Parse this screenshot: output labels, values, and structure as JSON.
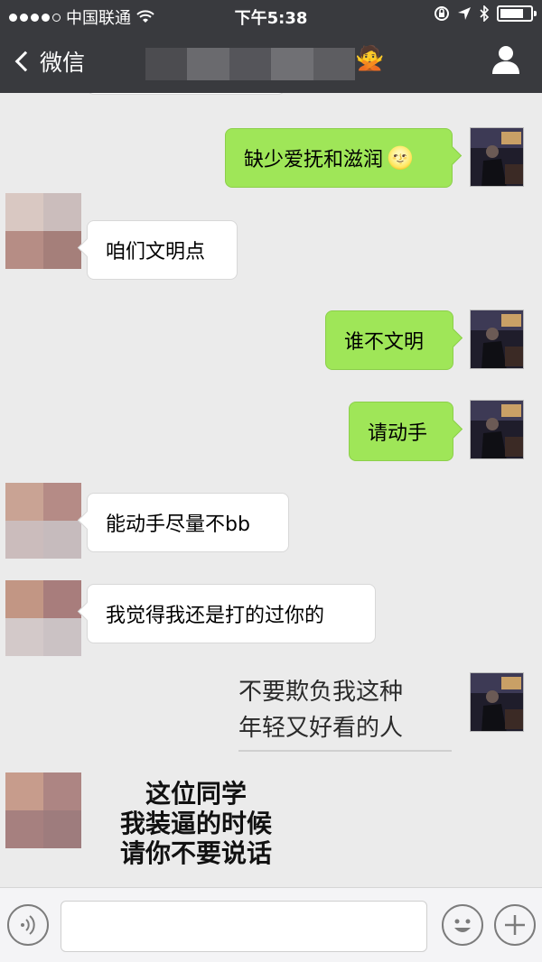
{
  "status_bar": {
    "carrier": "中国联通",
    "time": "下午5:38"
  },
  "nav": {
    "back_label": "微信",
    "contact_emoji": "🙅"
  },
  "messages": [
    {
      "side": "right",
      "text": "缺少爱抚和滋润",
      "emoji": "🌝"
    },
    {
      "side": "left",
      "text": "咱们文明点"
    },
    {
      "side": "right",
      "text": "谁不文明"
    },
    {
      "side": "right",
      "text": "请动手"
    },
    {
      "side": "left",
      "text": "能动手尽量不bb"
    },
    {
      "side": "left",
      "text": "我觉得我还是打的过你的"
    },
    {
      "side": "right",
      "type": "sticker",
      "lines": [
        "不要欺负我这种",
        "年轻又好看的人"
      ]
    },
    {
      "side": "left",
      "type": "sticker",
      "lines": [
        "这位同学",
        "我装逼的时候",
        "请你不要说话"
      ]
    }
  ],
  "colors": {
    "nav_bg": "#393a3e",
    "chat_bg": "#ebebeb",
    "bubble_green": "#9fe658",
    "bubble_white": "#ffffff"
  }
}
